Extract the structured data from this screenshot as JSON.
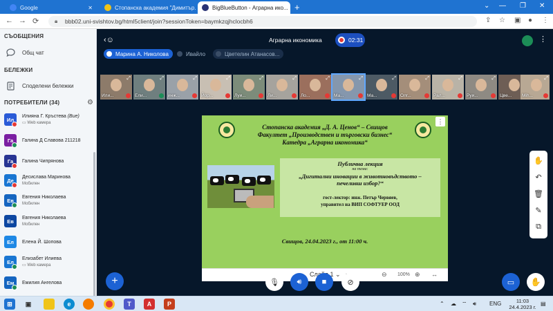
{
  "browser": {
    "tabs": [
      {
        "label": "Google",
        "color": "#4285f4"
      },
      {
        "label": "Стопанска академия \"Димитър...",
        "color": "#f0c419"
      },
      {
        "label": "BigBlueButton - Аграрна ико...",
        "color": "#283274"
      }
    ],
    "url": "bbb02.uni-svishtov.bg/html5client/join?sessionToken=baymkzqjhclocbh6"
  },
  "sidebar": {
    "messages_title": "СЪОБЩЕНИЯ",
    "public_chat": "Общ чат",
    "notes_title": "БЕЛЕЖКИ",
    "shared_notes": "Споделени бележки",
    "users_title": "ПОТРЕБИТЕЛИ (34)",
    "users": [
      {
        "initials": "Ил",
        "name": "Илияна Г. Кръстева",
        "suffix": "(Вие)",
        "sub": "Web камера",
        "color": "#2a5bd7",
        "status": "#e53935"
      },
      {
        "initials": "Га",
        "name": "Галина Д Славова 211218",
        "suffix": "",
        "sub": "",
        "color": "#7b1fa2",
        "status": "#1c8d57"
      },
      {
        "initials": "Га",
        "name": "Галина Чипрянова",
        "suffix": "",
        "sub": "",
        "color": "#283593",
        "status": "#e53935"
      },
      {
        "initials": "Де",
        "name": "Десислава Маринова",
        "suffix": "",
        "sub": "Мобилен",
        "color": "#1976d2",
        "status": "#e53935"
      },
      {
        "initials": "Ев",
        "name": "Евгения Николаева",
        "suffix": "",
        "sub": "Мобилен",
        "color": "#1565c0",
        "status": "#1c8d57"
      },
      {
        "initials": "Ев",
        "name": "Евгения Николаева",
        "suffix": "",
        "sub": "Мобилен",
        "color": "#0d47a1",
        "status": ""
      },
      {
        "initials": "Ел",
        "name": "Елена Й. Шопова",
        "suffix": "",
        "sub": "",
        "color": "#1e88e5",
        "status": ""
      },
      {
        "initials": "Ел",
        "name": "Елизабет Илиева",
        "suffix": "",
        "sub": "Web камера",
        "color": "#1976d2",
        "status": "#1c8d57"
      },
      {
        "initials": "Ем",
        "name": "Емилия Ангелова",
        "suffix": "",
        "sub": "",
        "color": "#1565c0",
        "status": "#1c8d57"
      }
    ]
  },
  "meeting": {
    "title": "Аграрна икономика",
    "timer": "02:31",
    "talkers": [
      {
        "name": "Марина А. Николова",
        "active": true
      },
      {
        "name": "Ивайло",
        "active": false
      },
      {
        "name": "Цветелин Атанасов...",
        "active": false
      }
    ],
    "video_tiles": [
      {
        "label": "Или...",
        "mic": "off"
      },
      {
        "label": "Ели...",
        "mic": "on"
      },
      {
        "label": "инж...",
        "mic": "off"
      },
      {
        "label": "Йор...",
        "mic": "off"
      },
      {
        "label": "Луи...",
        "mic": "off"
      },
      {
        "label": "Ли...",
        "mic": "off"
      },
      {
        "label": "Ло...",
        "mic": "off"
      },
      {
        "label": "Ма...",
        "mic": "off"
      },
      {
        "label": "Ма...",
        "mic": "off"
      },
      {
        "label": "Олг...",
        "mic": "off"
      },
      {
        "label": "Рал...",
        "mic": "off"
      },
      {
        "label": "Руи...",
        "mic": "off"
      },
      {
        "label": "Цве...",
        "mic": "off"
      },
      {
        "label": "Mih...",
        "mic": "off"
      }
    ]
  },
  "slide": {
    "line1": "Стопанска академия „Д. А. Ценов“ – Свищов",
    "line2": "Факултет „Производствен и търговски бизнес“",
    "line3": "Катедра „Аграрна икономика“",
    "lecture_title": "Публична лекция",
    "on_topic": "на тема:",
    "topic": "„Дигитални иновации в животновъдството – печеливш избор?“",
    "guest": "гост-лектор: инж. Петър Червяев,",
    "role": "управител на ВИП СОФТУЕР ООД",
    "place_date": "Свищов, 24.04.2023 г., от 11:00 ч.",
    "nav_label": "Слайд 1",
    "zoom": "100%"
  },
  "taskbar": {
    "lang": "ENG",
    "time": "11:03",
    "date": "24.4.2023 г."
  }
}
